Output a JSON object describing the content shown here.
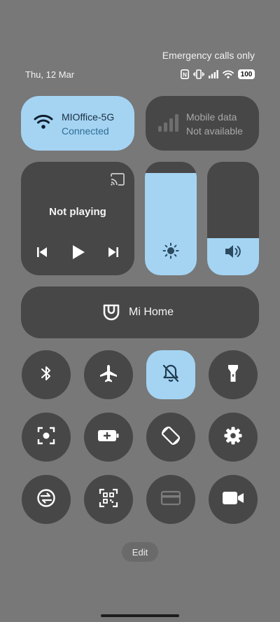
{
  "status": {
    "emergency": "Emergency calls only",
    "date": "Thu, 12 Mar",
    "battery": "100",
    "icons": [
      "nfc-icon",
      "vibrate-icon",
      "signal-icon",
      "wifi-icon",
      "battery-icon"
    ]
  },
  "network": {
    "wifi": {
      "title": "MIOffice-5G",
      "subtitle": "Connected",
      "icon": "wifi-icon"
    },
    "mobile": {
      "title": "Mobile data",
      "subtitle": "Not available",
      "icon": "signal-bars-icon"
    }
  },
  "media": {
    "status": "Not playing",
    "controls": [
      "previous-icon",
      "play-icon",
      "next-icon"
    ]
  },
  "sliders": {
    "brightness": {
      "icon": "brightness-icon",
      "level": 0.9
    },
    "volume": {
      "icon": "volume-icon",
      "level": 0.33
    }
  },
  "mihome": {
    "label": "Mi Home"
  },
  "toggles": [
    {
      "name": "bluetooth",
      "icon": "bluetooth-icon",
      "active": false
    },
    {
      "name": "airplane-mode",
      "icon": "airplane-icon",
      "active": false
    },
    {
      "name": "silent-mode",
      "icon": "bell-off-icon",
      "active": true
    },
    {
      "name": "flashlight",
      "icon": "flashlight-icon",
      "active": false
    },
    {
      "name": "screenshot",
      "icon": "screenshot-icon",
      "active": false
    },
    {
      "name": "battery-saver",
      "icon": "battery-saver-icon",
      "active": false
    },
    {
      "name": "auto-rotate",
      "icon": "rotate-icon",
      "active": false
    },
    {
      "name": "settings",
      "icon": "gear-icon",
      "active": false
    },
    {
      "name": "sync",
      "icon": "sync-icon",
      "active": false
    },
    {
      "name": "scanner",
      "icon": "qr-scan-icon",
      "active": false
    },
    {
      "name": "wallet",
      "icon": "card-icon",
      "active": false
    },
    {
      "name": "screen-recorder",
      "icon": "video-camera-icon",
      "active": false
    }
  ],
  "edit": {
    "label": "Edit"
  },
  "colors": {
    "background": "#787878",
    "tile": "#474747",
    "accent": "#a5d4f3"
  }
}
